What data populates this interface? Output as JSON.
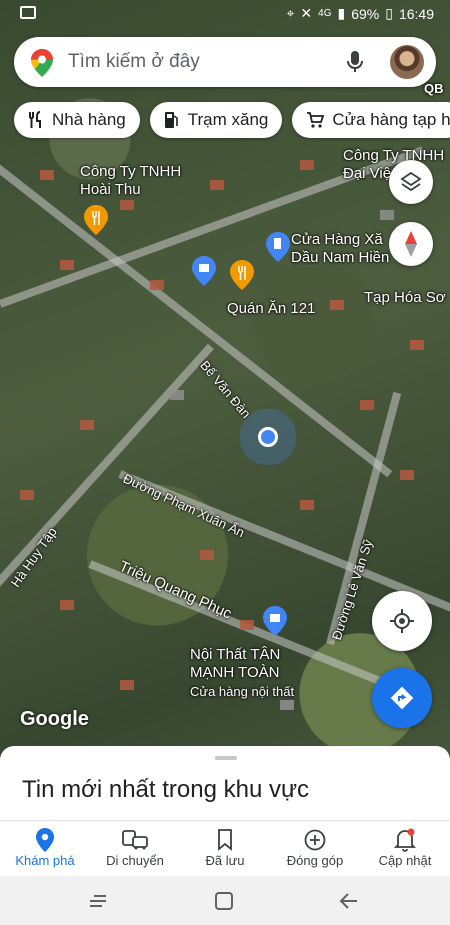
{
  "status_bar": {
    "right_text": "69%",
    "time": "16:49",
    "network": "4G"
  },
  "search": {
    "placeholder": "Tìm kiếm ở đây"
  },
  "chips": [
    {
      "label": "Nhà hàng",
      "icon": "fork-knife-icon"
    },
    {
      "label": "Trạm xăng",
      "icon": "gas-station-icon"
    },
    {
      "label": "Cửa hàng tạp h",
      "icon": "cart-icon"
    }
  ],
  "map_labels": {
    "poi1": "Công Ty TNHH",
    "poi1b": "Hoài Thu",
    "poi2": "Công Ty TNHH",
    "poi2b": "Đại Việ",
    "poi2c": "QB",
    "poi3": "Cửa Hàng Xă",
    "poi3b": "Dầu Nam Hiền",
    "poi4": "Tạp Hóa Sơ",
    "poi5": "Quán Ăn 121",
    "poi6": "Nội Thất TÂN",
    "poi6b": "MẠNH TOÀN",
    "poi6c": "Cửa hàng nội thất",
    "edge_badge": "QB"
  },
  "road_names": {
    "r1": "Bế Văn Đàn",
    "r2": "Đường Phạm Xuân Ẩn",
    "r3": "Hà Huy Tập",
    "r4": "Triệu Quang Phục",
    "r5": "Đường Lê Văn Sỹ"
  },
  "watermark": "Google",
  "sheet": {
    "title": "Tin mới nhất trong khu vực"
  },
  "bottom_nav": [
    {
      "label": "Khám phá",
      "icon": "explore-pin-icon",
      "active": true
    },
    {
      "label": "Di chuyển",
      "icon": "commute-icon",
      "active": false
    },
    {
      "label": "Đã lưu",
      "icon": "bookmark-icon",
      "active": false
    },
    {
      "label": "Đóng góp",
      "icon": "add-circle-icon",
      "active": false
    },
    {
      "label": "Cập nhật",
      "icon": "bell-icon",
      "active": false
    }
  ],
  "colors": {
    "accent": "#1a73e8",
    "fab_directions": "#1a73e8",
    "poi_orange": "#f29900",
    "poi_blue": "#4285f4"
  }
}
